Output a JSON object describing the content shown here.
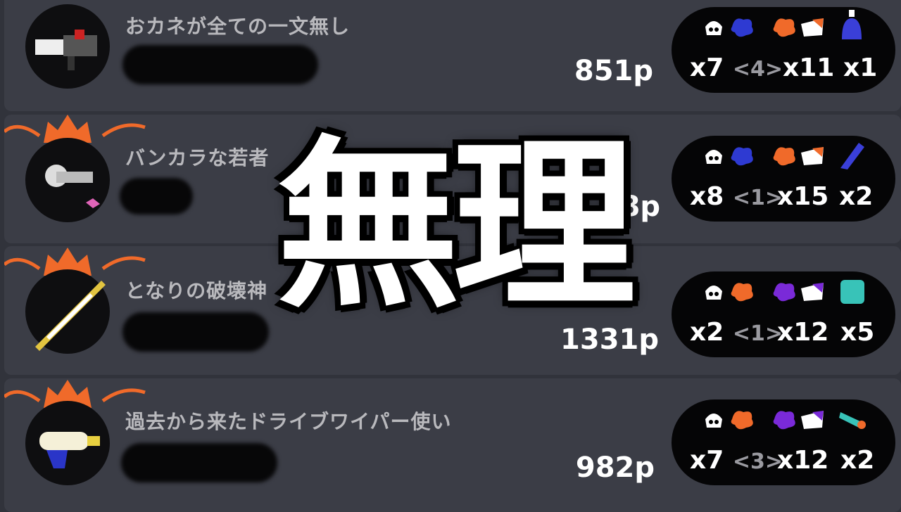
{
  "players": [
    {
      "name": "おカネが全ての一文無し",
      "points": "851p",
      "has_crown": false,
      "weapon_icon": "splatling-weapon-icon",
      "stat_icons": [
        "squid-splat-icon",
        "splat-blue-icon",
        "splat-orange-icon",
        "squid-death-icon",
        "special-tower-icon"
      ],
      "kills": "x7",
      "assists": "<4>",
      "deaths": "x11",
      "specials": "x1",
      "kill_color": "#2e3ad2",
      "death_color": "#f06a2a",
      "special_color": "#3a3fd8"
    },
    {
      "name": "バンカラな若者",
      "points": "8p",
      "has_crown": true,
      "weapon_icon": "splatling-gun-icon",
      "stat_icons": [
        "squid-splat-icon",
        "splat-blue-icon",
        "splat-orange-icon",
        "squid-death-icon",
        "special-wave-icon"
      ],
      "kills": "x8",
      "assists": "<1>",
      "deaths": "x15",
      "specials": "x2",
      "kill_color": "#2e3ad2",
      "death_color": "#f06a2a",
      "special_color": "#3a3fd8"
    },
    {
      "name": "となりの破壊神",
      "points": "1331p",
      "has_crown": true,
      "weapon_icon": "charger-icon",
      "stat_icons": [
        "squid-splat-icon",
        "splat-orange-icon",
        "splat-purple-icon",
        "squid-death-icon",
        "special-shield-icon"
      ],
      "kills": "x2",
      "assists": "<1>",
      "deaths": "x12",
      "specials": "x5",
      "kill_color": "#f06a2a",
      "death_color": "#7a2ad8",
      "special_color": "#38c3b8"
    },
    {
      "name": "過去から来たドライブワイパー使い",
      "points": "982p",
      "has_crown": true,
      "weapon_icon": "water-blaster-icon",
      "stat_icons": [
        "squid-splat-icon",
        "splat-orange-icon",
        "splat-purple-icon",
        "squid-death-icon",
        "special-missile-icon"
      ],
      "kills": "x7",
      "assists": "<3>",
      "deaths": "x12",
      "specials": "x2",
      "kill_color": "#f06a2a",
      "death_color": "#7a2ad8",
      "special_color": "#38c3b8"
    }
  ],
  "overlay_text": "無理"
}
